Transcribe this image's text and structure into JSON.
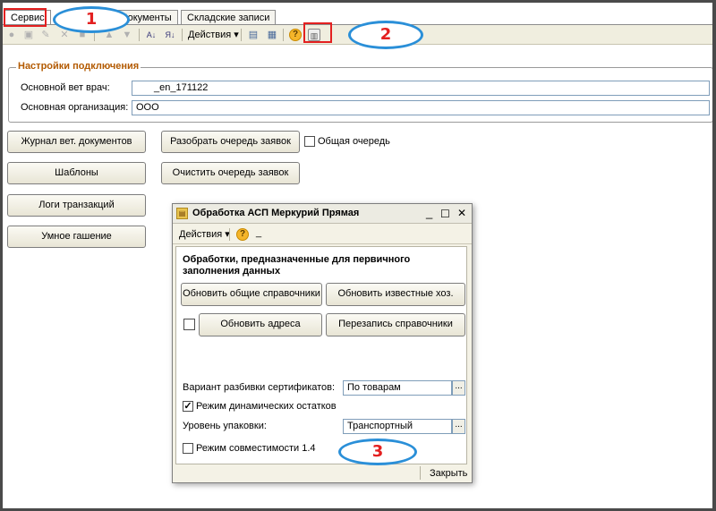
{
  "tabs": [
    "Сервис",
    "Документы",
    "Складские записи"
  ],
  "toolbar": {
    "actions_label": "Действия",
    "dropdown_arrow": "▾",
    "help_glyph": "?"
  },
  "settings": {
    "group_title": "Настройки подключения",
    "vet_label": "Основной вет врач:",
    "vet_value": "_en_171122",
    "org_label": "Основная организация:",
    "org_value": "ООО"
  },
  "buttons": {
    "journal": "Журнал вет. документов",
    "templates": "Шаблоны",
    "logs": "Логи транзакций",
    "smart_cancel": "Умное гашение",
    "parse_queue": "Разобрать очередь заявок",
    "clear_queue": "Очистить очередь заявок"
  },
  "common_queue_label": "Общая очередь",
  "dialog": {
    "title": "Обработка  АСП Меркурий Прямая",
    "actions_label": "Действия",
    "underscore": "_",
    "heading": "Обработки, предназначенные для первичного заполнения данных",
    "btn_update_common": "Обновить общие справочники",
    "btn_update_known": "Обновить известные хоз.",
    "btn_update_addresses": "Обновить адреса",
    "btn_rewrite": "Перезапись справочники",
    "cert_split_label": "Вариант разбивки сертификатов:",
    "cert_split_value": "По товарам",
    "dynamic_stock_label": "Режим динамических остатков",
    "packing_label": "Уровень упаковки:",
    "packing_value": "Транспортный",
    "compat_label": "Режим совместимости 1.4",
    "close": "Закрыть",
    "ellipsis": "...",
    "win_min": "_",
    "win_max": "☐",
    "win_close": "✕"
  },
  "callouts": [
    "1",
    "2",
    "3"
  ],
  "colors": {
    "accent_orange": "#b35a00",
    "highlight_red": "#e32020",
    "callout_blue": "#2a8fd8"
  }
}
